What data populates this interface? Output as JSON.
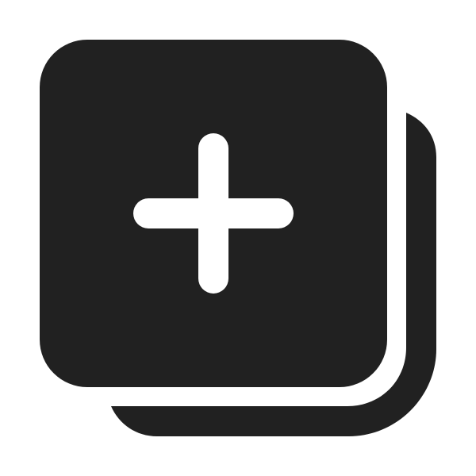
{
  "icon": {
    "name": "add-square-multiple-icon",
    "colors": {
      "background": "#ffffff",
      "fill": "#212121",
      "plus": "#ffffff"
    }
  }
}
